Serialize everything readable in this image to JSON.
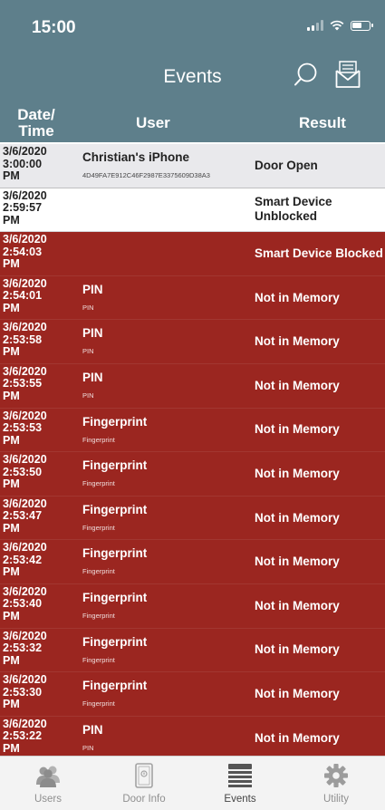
{
  "status": {
    "time": "15:00"
  },
  "nav": {
    "title": "Events"
  },
  "table": {
    "headers": {
      "date": "Date/\nTime",
      "user": "User",
      "result": "Result"
    },
    "rows": [
      {
        "style": "light",
        "date": "3/6/2020\n3:00:00\nPM",
        "user": "Christian's iPhone",
        "sub": "4D49FA7E912C46F2987E3375609D38A3",
        "result": "Door Open"
      },
      {
        "style": "white",
        "date": "3/6/2020\n2:59:57\nPM",
        "user": "",
        "sub": "",
        "result": "Smart Device\nUnblocked"
      },
      {
        "style": "red",
        "date": "3/6/2020\n2:54:03\nPM",
        "user": "",
        "sub": "",
        "result": "Smart Device Blocked"
      },
      {
        "style": "red",
        "date": "3/6/2020\n2:54:01\nPM",
        "user": "PIN",
        "sub": "PIN",
        "result": "Not in Memory"
      },
      {
        "style": "red",
        "date": "3/6/2020\n2:53:58\nPM",
        "user": "PIN",
        "sub": "PIN",
        "result": "Not in Memory"
      },
      {
        "style": "red",
        "date": "3/6/2020\n2:53:55\nPM",
        "user": "PIN",
        "sub": "PIN",
        "result": "Not in Memory"
      },
      {
        "style": "red",
        "date": "3/6/2020\n2:53:53\nPM",
        "user": "Fingerprint",
        "sub": "Fingerprint",
        "result": "Not in Memory"
      },
      {
        "style": "red",
        "date": "3/6/2020\n2:53:50\nPM",
        "user": "Fingerprint",
        "sub": "Fingerprint",
        "result": "Not in Memory"
      },
      {
        "style": "red",
        "date": "3/6/2020\n2:53:47\nPM",
        "user": "Fingerprint",
        "sub": "Fingerprint",
        "result": "Not in Memory"
      },
      {
        "style": "red",
        "date": "3/6/2020\n2:53:42\nPM",
        "user": "Fingerprint",
        "sub": "Fingerprint",
        "result": "Not in Memory"
      },
      {
        "style": "red",
        "date": "3/6/2020\n2:53:40\nPM",
        "user": "Fingerprint",
        "sub": "Fingerprint",
        "result": "Not in Memory"
      },
      {
        "style": "red",
        "date": "3/6/2020\n2:53:32\nPM",
        "user": "Fingerprint",
        "sub": "Fingerprint",
        "result": "Not in Memory"
      },
      {
        "style": "red",
        "date": "3/6/2020\n2:53:30\nPM",
        "user": "Fingerprint",
        "sub": "Fingerprint",
        "result": "Not in Memory"
      },
      {
        "style": "red",
        "date": "3/6/2020\n2:53:22\nPM",
        "user": "PIN",
        "sub": "PIN",
        "result": "Not in Memory"
      }
    ]
  },
  "tabbar": {
    "items": [
      {
        "label": "Users",
        "icon": "users-icon"
      },
      {
        "label": "Door Info",
        "icon": "door-info-icon"
      },
      {
        "label": "Events",
        "icon": "events-list-icon",
        "active": true
      },
      {
        "label": "Utility",
        "icon": "gear-icon"
      }
    ]
  },
  "colors": {
    "header": "#5e7f8b",
    "alert_row": "#9b2620",
    "normal_row": "#e9e9ec"
  }
}
